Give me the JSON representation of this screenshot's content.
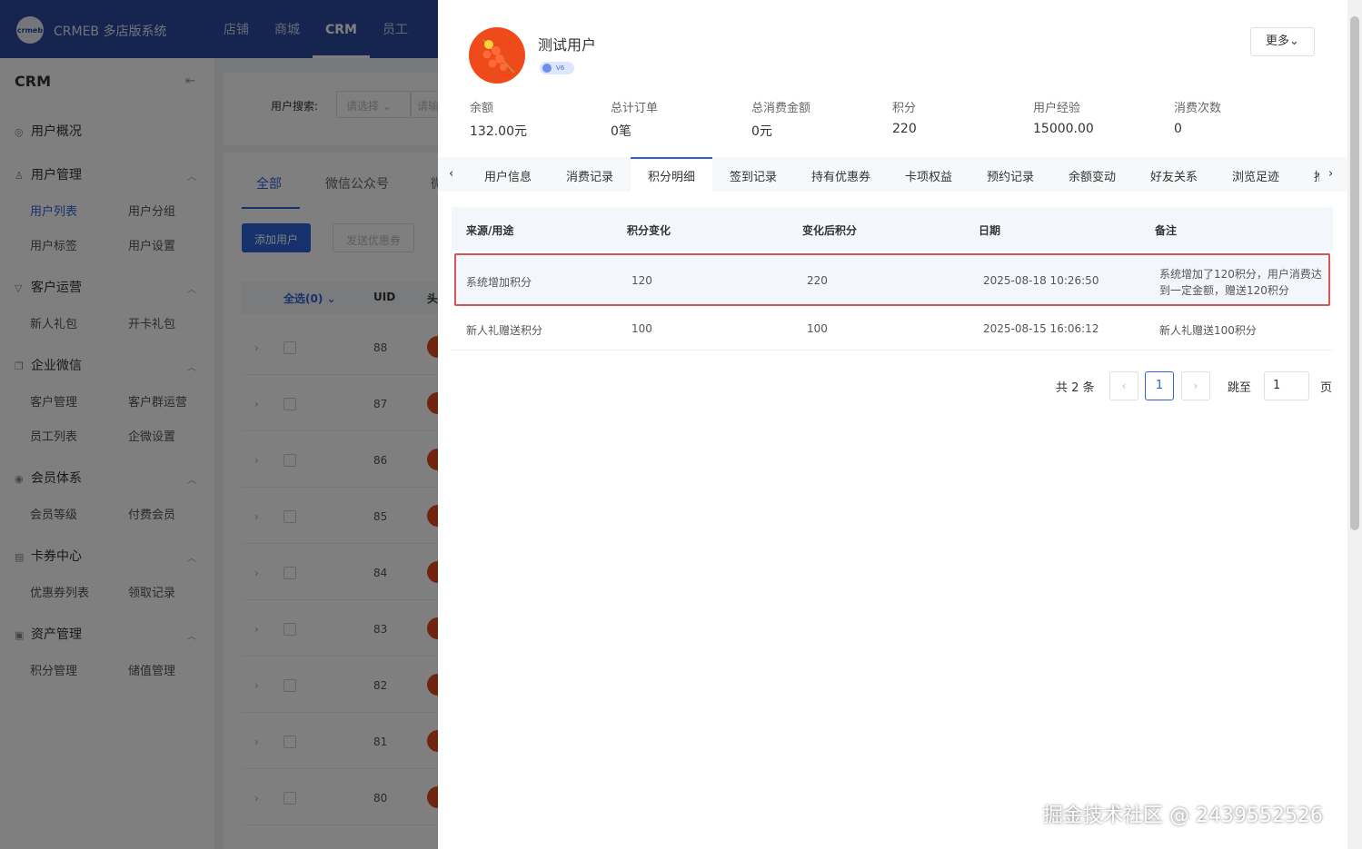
{
  "app": {
    "brand": "CRMEB 多店版系统",
    "logo_text": "crmeb",
    "top_nav": [
      "店铺",
      "商城",
      "CRM",
      "员工"
    ]
  },
  "sidebar": {
    "title": "CRM",
    "groups": [
      {
        "label": "用户概况",
        "items": []
      },
      {
        "label": "用户管理",
        "items": [
          "用户列表",
          "用户分组",
          "用户标签",
          "用户设置"
        ]
      },
      {
        "label": "客户运营",
        "items": [
          "新人礼包",
          "开卡礼包"
        ]
      },
      {
        "label": "企业微信",
        "items": [
          "客户管理",
          "客户群运营",
          "员工列表",
          "企微设置"
        ]
      },
      {
        "label": "会员体系",
        "items": [
          "会员等级",
          "付费会员"
        ]
      },
      {
        "label": "卡券中心",
        "items": [
          "优惠券列表",
          "领取记录"
        ]
      },
      {
        "label": "资产管理",
        "items": [
          "积分管理",
          "储值管理"
        ]
      }
    ]
  },
  "background": {
    "search_label": "用户搜索:",
    "search_select": "请选择",
    "search_input": "请输",
    "tabs": [
      "全部",
      "微信公众号",
      "微"
    ],
    "add_user": "添加用户",
    "send_coupon": "发送优惠券",
    "headers": {
      "select_all": "全选(0)",
      "uid": "UID",
      "avatar": "头"
    },
    "uids": [
      "88",
      "87",
      "86",
      "85",
      "84",
      "83",
      "82",
      "81",
      "80"
    ]
  },
  "drawer": {
    "user_name": "测试用户",
    "level_badge": "V6",
    "more_button": "更多",
    "stats": [
      {
        "label": "余额",
        "value": "132.00元"
      },
      {
        "label": "总计订单",
        "value": "0笔"
      },
      {
        "label": "总消费金额",
        "value": "0元"
      },
      {
        "label": "积分",
        "value": "220"
      },
      {
        "label": "用户经验",
        "value": "15000.00"
      },
      {
        "label": "消费次数",
        "value": "0"
      }
    ],
    "tabs": [
      "用户信息",
      "消费记录",
      "积分明细",
      "签到记录",
      "持有优惠券",
      "卡项权益",
      "预约记录",
      "余额变动",
      "好友关系",
      "浏览足迹",
      "推"
    ],
    "active_tab": "积分明细",
    "table": {
      "columns": [
        "来源/用途",
        "积分变化",
        "变化后积分",
        "日期",
        "备注"
      ],
      "rows": [
        {
          "source": "系统增加积分",
          "change": "120",
          "after": "220",
          "date": "2025-08-18 10:26:50",
          "note_line1": "系统增加了120积分，用户消费达",
          "note_line2": "到一定金额，赠送120积分"
        },
        {
          "source": "新人礼赠送积分",
          "change": "100",
          "after": "100",
          "date": "2025-08-15 16:06:12",
          "note_line1": "新人礼赠送100积分",
          "note_line2": ""
        }
      ]
    },
    "pagination": {
      "total": "共 2 条",
      "current_page": "1",
      "jump_label": "跳至",
      "jump_value": "1",
      "page_unit": "页"
    }
  },
  "watermark": "掘金技术社区 @ 2439552526",
  "colors": {
    "primary": "#2d62d9",
    "topbar": "#2d4b9f",
    "highlight_border": "#d9534f"
  }
}
